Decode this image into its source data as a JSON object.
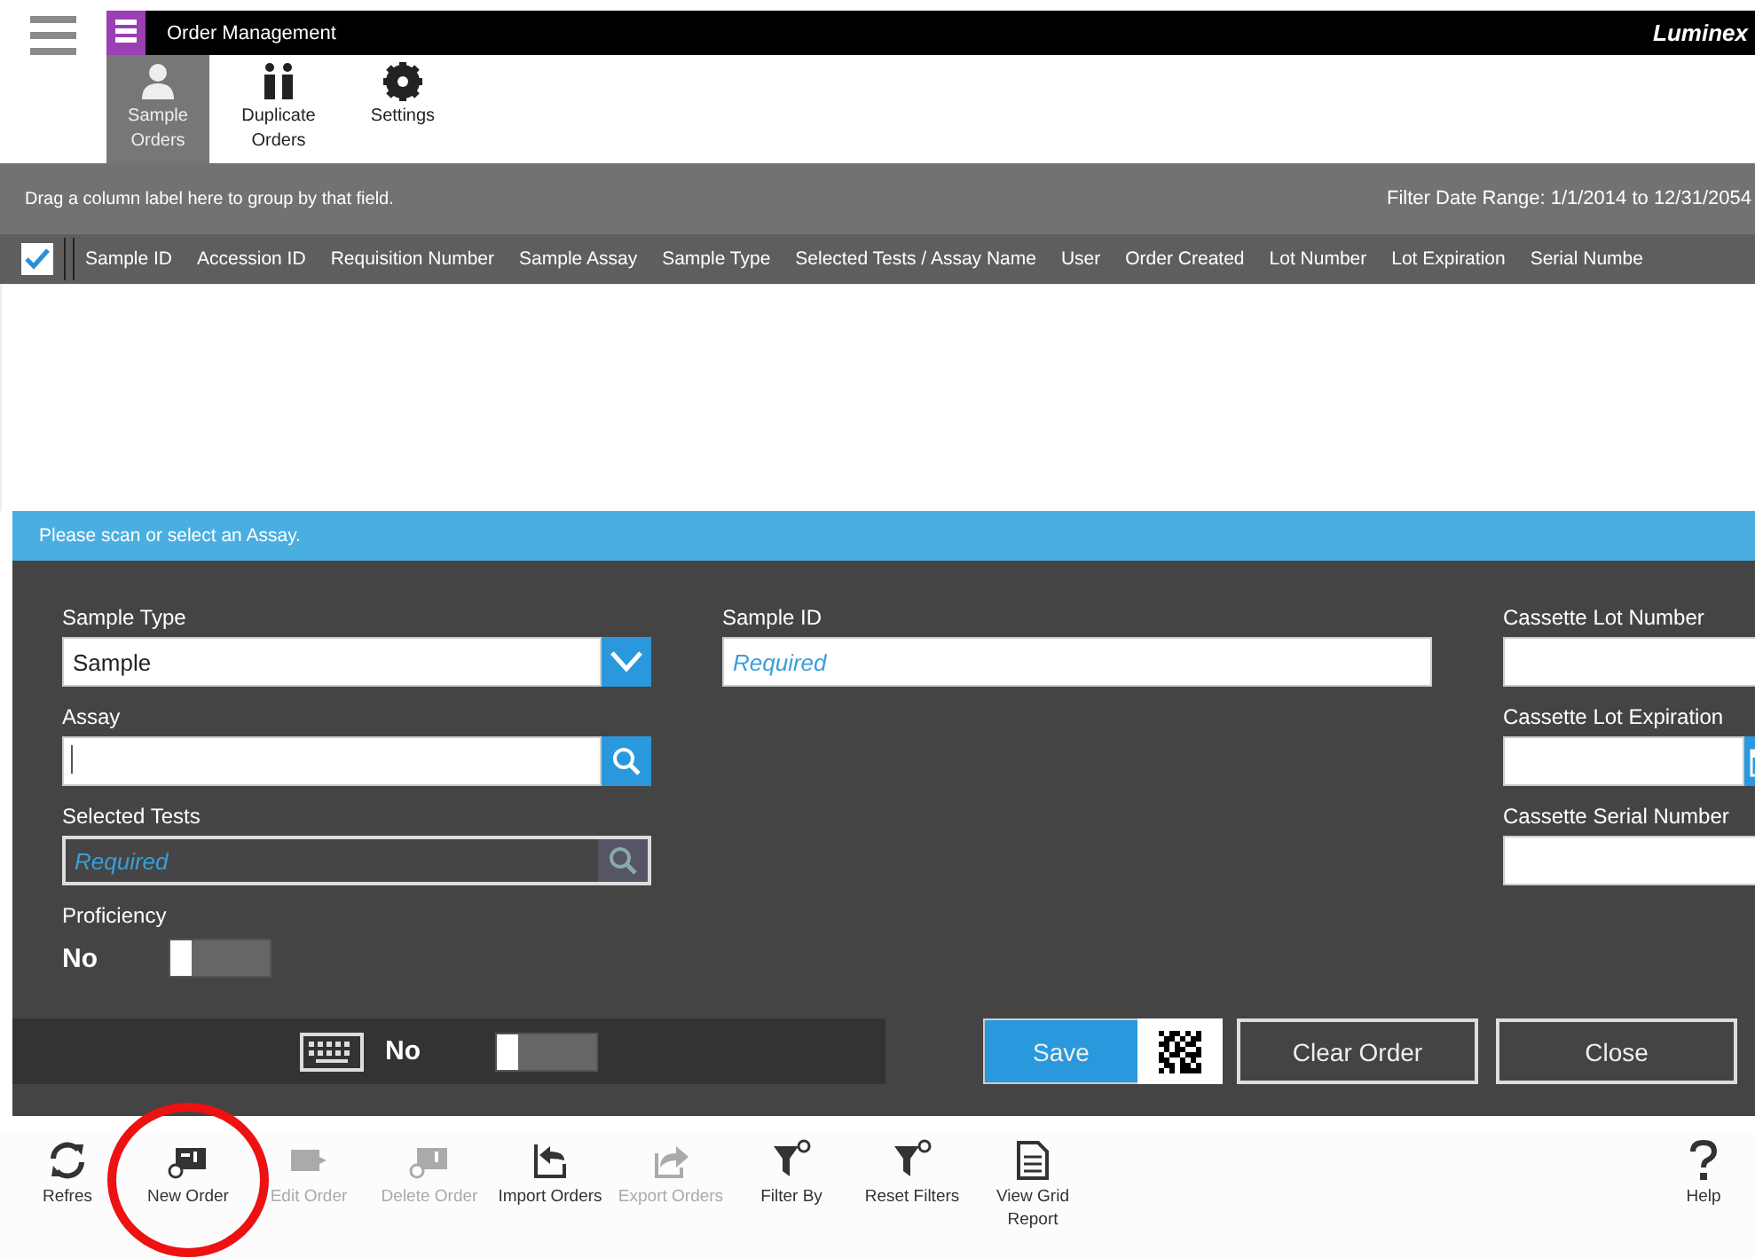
{
  "window": {
    "title": "Order Management",
    "brand": "Luminex"
  },
  "tabs": [
    {
      "label": "Sample Orders",
      "kind": "person",
      "selected": true
    },
    {
      "label": "Duplicate Orders",
      "kind": "pair",
      "selected": false
    },
    {
      "label": "Settings",
      "kind": "gear",
      "selected": false
    }
  ],
  "grid": {
    "group_hint": "Drag a column label here to group by that field.",
    "filter_range": "Filter Date Range: 1/1/2014 to 12/31/2054",
    "select_all_checked": true,
    "columns": [
      "Sample ID",
      "Accession ID",
      "Requisition Number",
      "Sample Assay",
      "Sample Type",
      "Selected Tests / Assay Name",
      "User",
      "Order Created",
      "Lot Number",
      "Lot Expiration",
      "Serial Numbe"
    ]
  },
  "form": {
    "message": "Please scan or select an Assay.",
    "columns": [
      [
        {
          "label": "Sample Type",
          "kind": "dropdown",
          "value": "Sample",
          "disabled": false
        },
        {
          "label": "Assay",
          "kind": "search",
          "disabled": false
        },
        {
          "label": "Selected Tests",
          "kind": "search",
          "placeholder": "Required",
          "disabled": true
        },
        {
          "label": "Proficiency",
          "kind": "toggle",
          "state_text": "No",
          "on": false
        }
      ],
      [
        {
          "label": "Sample ID",
          "kind": "text",
          "placeholder": "Required",
          "disabled": false
        }
      ],
      [
        {
          "label": "Cassette Lot Number",
          "kind": "text",
          "disabled": false
        },
        {
          "label": "Cassette Lot Expiration",
          "kind": "date",
          "disabled": false
        },
        {
          "label": "Cassette Serial Number",
          "kind": "text",
          "disabled": false
        }
      ]
    ],
    "keyboard_toggle": {
      "state_text": "No",
      "on": false
    },
    "buttons": [
      {
        "label": "Save",
        "kind": "primary"
      },
      {
        "label": "Clear Order",
        "kind": "outline"
      },
      {
        "label": "Close",
        "kind": "outline"
      }
    ]
  },
  "toolbar": [
    {
      "label": "Refres",
      "kind": "refresh",
      "disabled": false,
      "highlighted": false
    },
    {
      "label": "New Order",
      "kind": "new",
      "disabled": false,
      "highlighted": true
    },
    {
      "label": "Edit Order",
      "kind": "edit",
      "disabled": true,
      "highlighted": false
    },
    {
      "label": "Delete Order",
      "kind": "delete",
      "disabled": true,
      "highlighted": false
    },
    {
      "label": "Import Orders",
      "kind": "import",
      "disabled": false,
      "highlighted": false
    },
    {
      "label": "Export Orders",
      "kind": "export",
      "disabled": true,
      "highlighted": false
    },
    {
      "label": "Filter By",
      "kind": "filter",
      "disabled": false,
      "highlighted": false
    },
    {
      "label": "Reset Filters",
      "kind": "reset",
      "disabled": false,
      "highlighted": false
    },
    {
      "label": "View Grid Report",
      "kind": "report",
      "disabled": false,
      "highlighted": false
    }
  ],
  "help": {
    "label": "Help"
  }
}
